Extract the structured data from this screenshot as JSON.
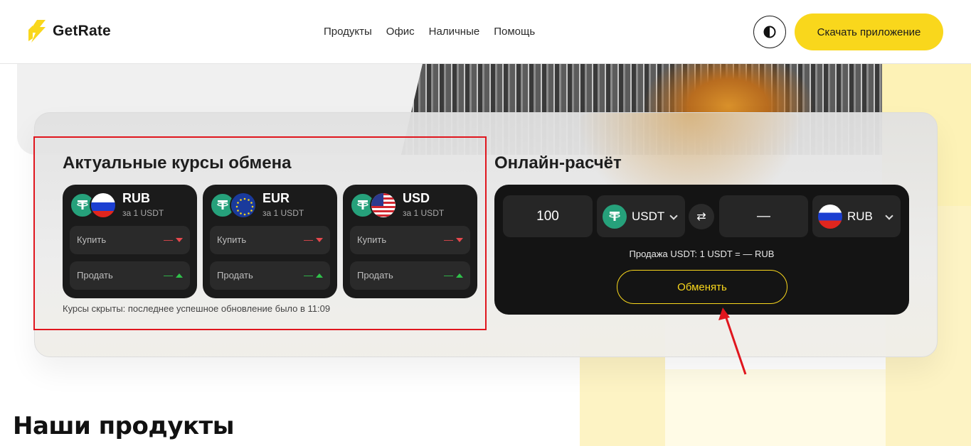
{
  "header": {
    "logo_text": "GetRate",
    "nav": [
      "Продукты",
      "Офис",
      "Наличные",
      "Помощь"
    ],
    "download_label": "Скачать приложение"
  },
  "rates": {
    "title": "Актуальные курсы обмена",
    "cards": [
      {
        "currency": "RUB",
        "sub": "за 1 USDT",
        "buy_label": "Купить",
        "buy_value": "—",
        "sell_label": "Продать",
        "sell_value": "—"
      },
      {
        "currency": "EUR",
        "sub": "за 1 USDT",
        "buy_label": "Купить",
        "buy_value": "—",
        "sell_label": "Продать",
        "sell_value": "—"
      },
      {
        "currency": "USD",
        "sub": "за 1 USDT",
        "buy_label": "Купить",
        "buy_value": "—",
        "sell_label": "Продать",
        "sell_value": "—"
      }
    ],
    "note": "Курсы скрыты: последнее успешное обновление было в 11:09"
  },
  "calculator": {
    "title": "Онлайн-расчёт",
    "amount": "100",
    "from_currency": "USDT",
    "to_amount": "—",
    "to_currency": "RUB",
    "rate_note": "Продажа USDT: 1 USDT = — RUB",
    "exchange_label": "Обменять"
  },
  "products": {
    "title": "Наши продукты"
  },
  "colors": {
    "accent": "#f9d71c",
    "tether": "#26a17b",
    "card_bg": "#1b1b1b",
    "annotation_red": "#e0161e"
  }
}
